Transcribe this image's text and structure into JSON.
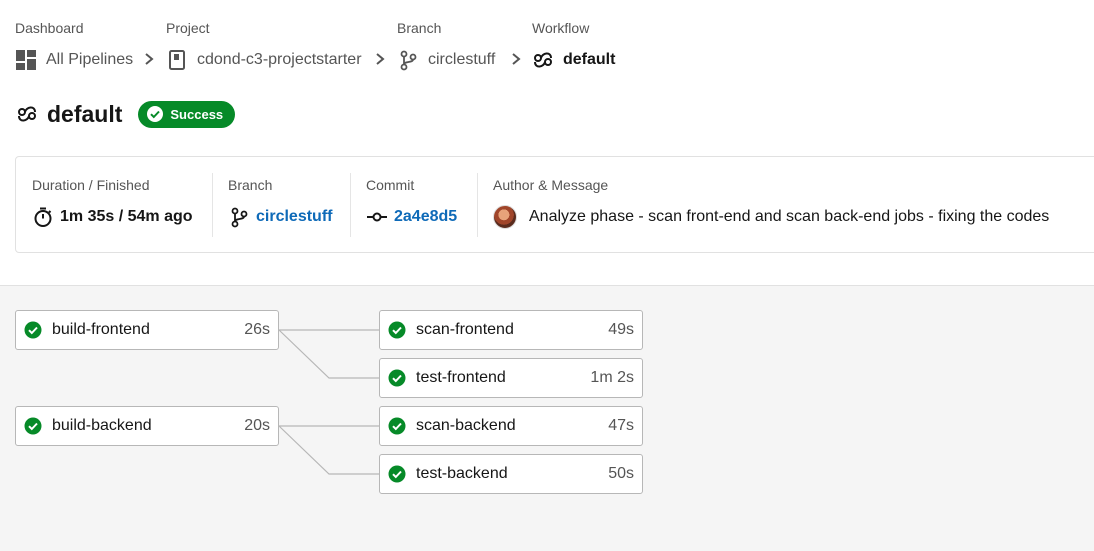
{
  "breadcrumbs": [
    {
      "heading": "Dashboard",
      "label": "All Pipelines",
      "icon": "dashboard-icon"
    },
    {
      "heading": "Project",
      "label": "cdond-c3-projectstarter",
      "icon": "repo-icon"
    },
    {
      "heading": "Branch",
      "label": "circlestuff",
      "icon": "branch-icon"
    },
    {
      "heading": "Workflow",
      "label": "default",
      "icon": "workflow-icon"
    }
  ],
  "workflow": {
    "title": "default",
    "status": "Success",
    "status_color": "#068a28"
  },
  "details": {
    "duration": {
      "label": "Duration / Finished",
      "value": "1m 35s / 54m ago"
    },
    "branch": {
      "label": "Branch",
      "value": "circlestuff"
    },
    "commit": {
      "label": "Commit",
      "value": "2a4e8d5"
    },
    "author": {
      "label": "Author & Message",
      "message": "Analyze phase - scan front-end and scan back-end jobs - fixing the codes"
    }
  },
  "jobs": [
    {
      "name": "build-frontend",
      "duration": "26s",
      "status": "success"
    },
    {
      "name": "scan-frontend",
      "duration": "49s",
      "status": "success"
    },
    {
      "name": "test-frontend",
      "duration": "1m 2s",
      "status": "success"
    },
    {
      "name": "build-backend",
      "duration": "20s",
      "status": "success"
    },
    {
      "name": "scan-backend",
      "duration": "47s",
      "status": "success"
    },
    {
      "name": "test-backend",
      "duration": "50s",
      "status": "success"
    }
  ],
  "colors": {
    "link": "#0e6ab8",
    "success": "#068a28"
  }
}
